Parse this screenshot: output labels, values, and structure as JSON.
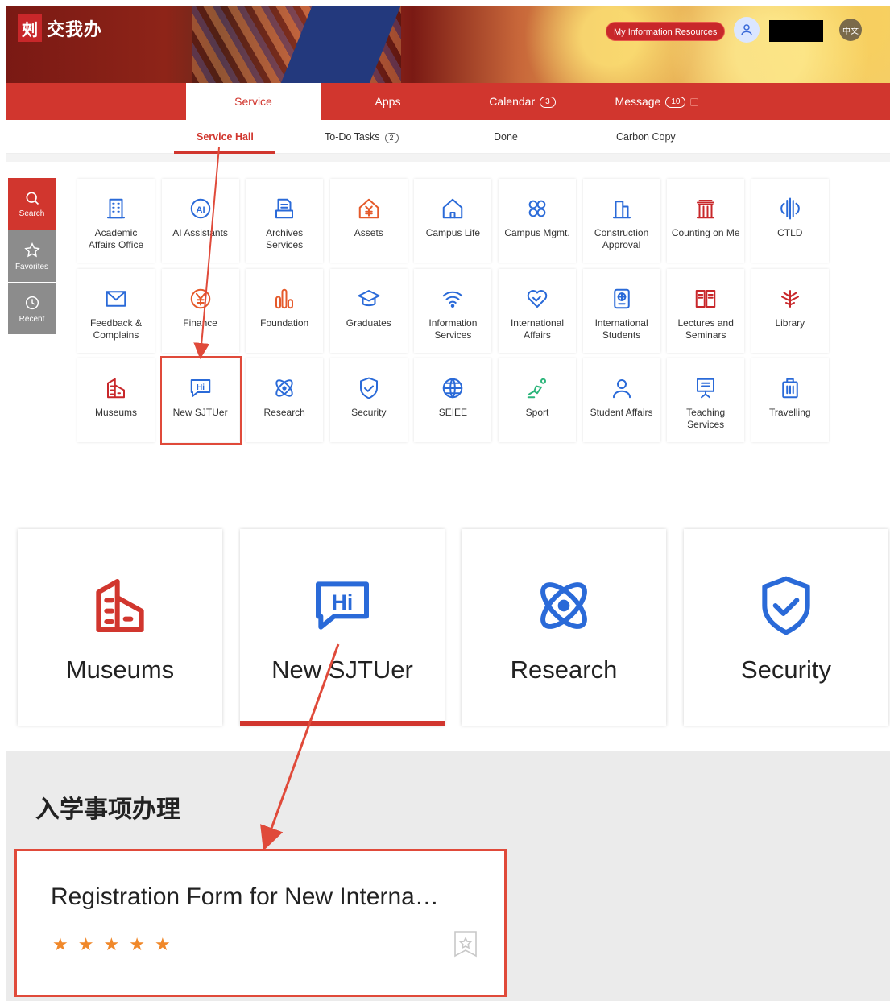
{
  "header": {
    "app_name": "交我办",
    "logo_glyph": "㓨",
    "info_button": "My Information Resources",
    "lang_button": "中文"
  },
  "main_nav": [
    {
      "label": "Service",
      "badge": ""
    },
    {
      "label": "Apps",
      "badge": ""
    },
    {
      "label": "Calendar",
      "badge": "3"
    },
    {
      "label": "Message",
      "badge": "10"
    }
  ],
  "sub_nav": [
    {
      "label": "Service Hall",
      "badge": ""
    },
    {
      "label": "To-Do Tasks",
      "badge": "2"
    },
    {
      "label": "Done",
      "badge": ""
    },
    {
      "label": "Carbon Copy",
      "badge": ""
    }
  ],
  "side_bar": [
    {
      "label": "Search",
      "icon": "search-icon"
    },
    {
      "label": "Favorites",
      "icon": "star-icon"
    },
    {
      "label": "Recent",
      "icon": "clock-icon"
    }
  ],
  "services": [
    {
      "label": "Academic\nAffairs Office",
      "icon": "building-icon",
      "color": "#2a6ad8"
    },
    {
      "label": "AI Assistants",
      "icon": "ai-icon",
      "color": "#2a6ad8"
    },
    {
      "label": "Archives\nServices",
      "icon": "archive-icon",
      "color": "#2a6ad8"
    },
    {
      "label": "Assets",
      "icon": "yuan-house-icon",
      "color": "#e55a2b"
    },
    {
      "label": "Campus Life",
      "icon": "home-icon",
      "color": "#2a6ad8"
    },
    {
      "label": "Campus Mgmt.",
      "icon": "grid-icon",
      "color": "#2a6ad8"
    },
    {
      "label": "Construction\nApproval",
      "icon": "construction-icon",
      "color": "#2a6ad8"
    },
    {
      "label": "Counting on Me",
      "icon": "gate-icon",
      "color": "#c8272a"
    },
    {
      "label": "CTLD",
      "icon": "ctld-icon",
      "color": "#2a6ad8"
    },
    {
      "label": "Feedback &\nComplains",
      "icon": "mail-icon",
      "color": "#2a6ad8"
    },
    {
      "label": "Finance",
      "icon": "yuan-coin-icon",
      "color": "#e55a2b"
    },
    {
      "label": "Foundation",
      "icon": "bar-chart-icon",
      "color": "#e55a2b"
    },
    {
      "label": "Graduates",
      "icon": "graduation-cap-icon",
      "color": "#2a6ad8"
    },
    {
      "label": "Information\nServices",
      "icon": "wifi-icon",
      "color": "#2a6ad8"
    },
    {
      "label": "International\nAffairs",
      "icon": "handshake-heart-icon",
      "color": "#2a6ad8"
    },
    {
      "label": "International\nStudents",
      "icon": "passport-icon",
      "color": "#2a6ad8"
    },
    {
      "label": "Lectures and\nSeminars",
      "icon": "book-icon",
      "color": "#c8272a"
    },
    {
      "label": "Library",
      "icon": "library-icon",
      "color": "#c8272a"
    },
    {
      "label": "Museums",
      "icon": "museum-icon",
      "color": "#c8272a"
    },
    {
      "label": "New SJTUer",
      "icon": "hi-bubble-icon",
      "color": "#2a6ad8"
    },
    {
      "label": "Research",
      "icon": "atom-icon",
      "color": "#2a6ad8"
    },
    {
      "label": "Security",
      "icon": "shield-check-icon",
      "color": "#2a6ad8"
    },
    {
      "label": "SEIEE",
      "icon": "globe-icon",
      "color": "#2a6ad8"
    },
    {
      "label": "Sport",
      "icon": "runner-icon",
      "color": "#2bb57a"
    },
    {
      "label": "Student Affairs",
      "icon": "user-icon",
      "color": "#2a6ad8"
    },
    {
      "label": "Teaching\nServices",
      "icon": "presentation-icon",
      "color": "#2a6ad8"
    },
    {
      "label": "Travelling",
      "icon": "suitcase-icon",
      "color": "#2a6ad8"
    }
  ],
  "zoom_cards": [
    {
      "label": "Museums",
      "icon": "museum-icon",
      "color": "#d1362e"
    },
    {
      "label": "New SJTUer",
      "icon": "hi-bubble-icon",
      "color": "#2a6ad8"
    },
    {
      "label": "Research",
      "icon": "atom-icon",
      "color": "#2a6ad8"
    },
    {
      "label": "Security",
      "icon": "shield-check-icon",
      "color": "#2a6ad8"
    }
  ],
  "detail": {
    "heading": "入学事项办理",
    "card_title": "Registration Form for New Interna…",
    "rating": 5
  },
  "colors": {
    "accent": "#d1362e",
    "annotation": "#e04a3a"
  }
}
